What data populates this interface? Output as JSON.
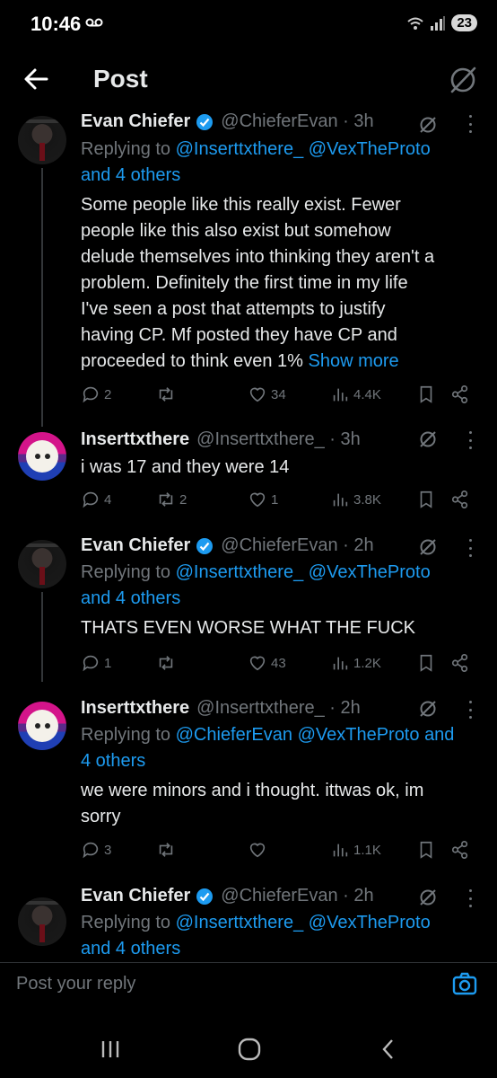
{
  "status_bar": {
    "time": "10:46",
    "battery": "23"
  },
  "header": {
    "title": "Post"
  },
  "posts": [
    {
      "name": "Evan Chiefer",
      "handle_time": "@ChieferEvan · 3h",
      "reply_prefix": "Replying to ",
      "mention_1": "@Inserttxthere_",
      "mention_2": "@VexTheProto",
      "others": "and 4 others",
      "lines": [
        "Some people like this really exist. Fewer",
        "people like this also exist but somehow",
        "delude themselves into thinking they aren't a",
        "problem. Definitely the first time in my life",
        "I've seen a post that attempts to justify",
        "having CP. Mf posted they have CP and",
        "proceeded to think even 1%"
      ],
      "show_more": "Show more",
      "replies": "2",
      "reposts": "",
      "likes": "34",
      "views": "4.4K"
    },
    {
      "name": "Inserttxthere",
      "handle_time": "@Inserttxthere_ · 3h",
      "text": "i was 17 and they were 14",
      "replies": "4",
      "reposts": "2",
      "likes": "1",
      "views": "3.8K"
    },
    {
      "name": "Evan Chiefer",
      "handle_time": "@ChieferEvan · 2h",
      "reply_prefix": "Replying to ",
      "mention_1": "@Inserttxthere_",
      "mention_2": "@VexTheProto",
      "others": "and 4 others",
      "text": "THATS EVEN WORSE WHAT THE FUCK",
      "replies": "1",
      "reposts": "",
      "likes": "43",
      "views": "1.2K"
    },
    {
      "name": "Inserttxthere",
      "handle_time": "@Inserttxthere_ · 2h",
      "reply_prefix": "Replying to ",
      "mention_1": "@ChieferEvan",
      "mention_2": "@VexTheProto",
      "others_line1": "and",
      "others_line2": "4 others",
      "lines": [
        "we were minors and i thought. ittwas ok, im",
        "sorry"
      ],
      "replies": "3",
      "reposts": "",
      "likes": "",
      "views": "1.1K"
    },
    {
      "name": "Evan Chiefer",
      "handle_time": "@ChieferEvan · 2h",
      "reply_prefix": "Replying to ",
      "mention_1": "@Inserttxthere_",
      "mention_2": "@VexTheProto",
      "others": "and 4 others"
    }
  ],
  "composer": {
    "placeholder": "Post your reply"
  },
  "icons": {
    "back": "back-arrow-icon",
    "grok": "grok-icon",
    "verified": "verified-badge-icon",
    "reply": "reply-icon",
    "repost": "repost-icon",
    "like": "heart-icon",
    "views": "views-icon",
    "bookmark": "bookmark-icon",
    "share": "share-icon",
    "camera": "camera-icon"
  },
  "colors": {
    "background": "#000000",
    "text": "#e7e9ea",
    "muted": "#71767b",
    "link": "#1d9bf0"
  }
}
